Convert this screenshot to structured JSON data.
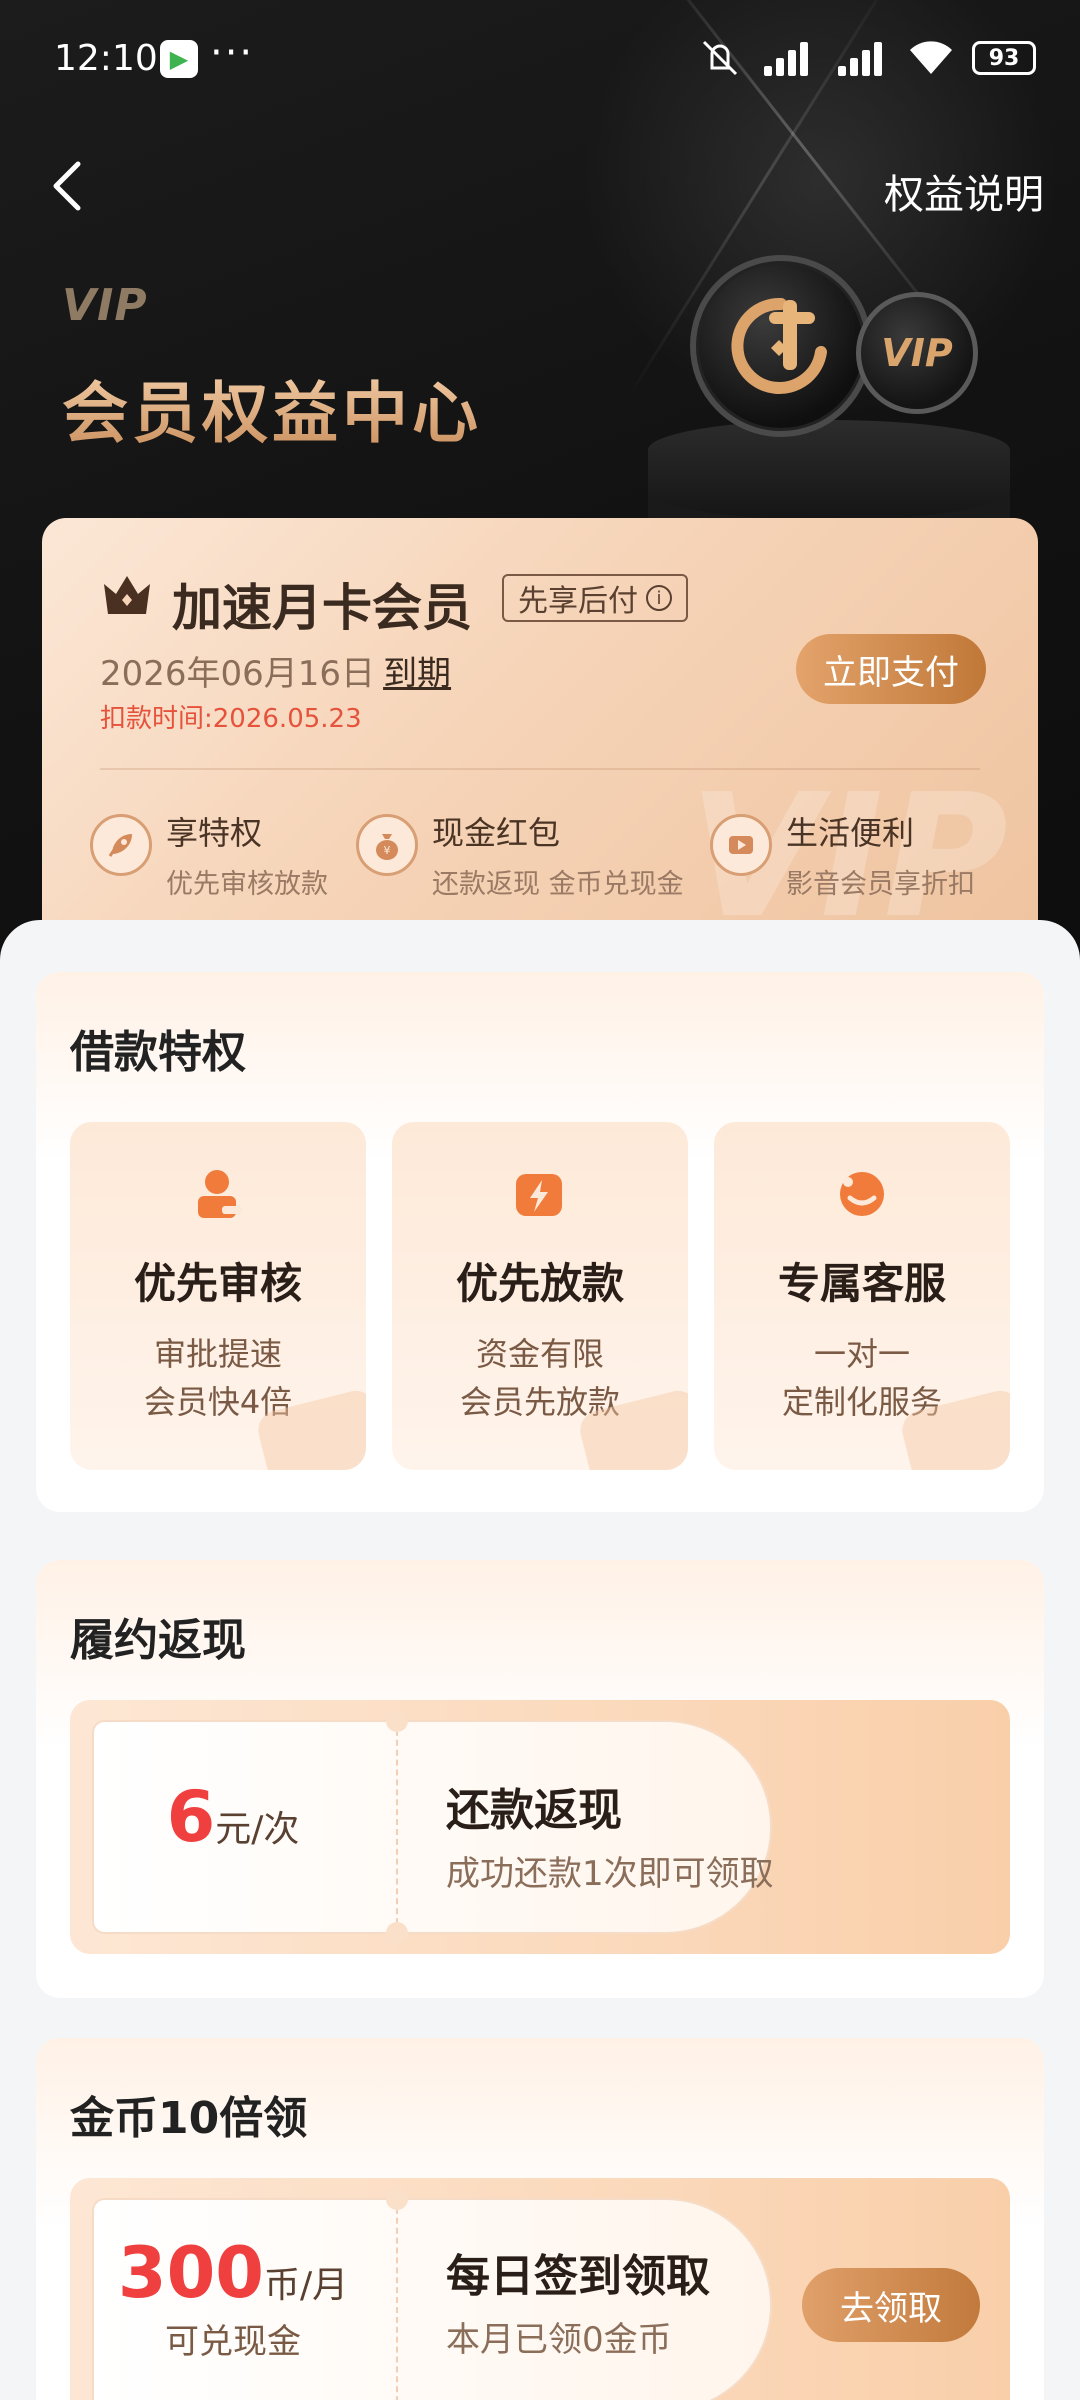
{
  "status_bar": {
    "time": "12:10",
    "more": "···",
    "battery": "93"
  },
  "header": {
    "vip_mark": "VIP",
    "title": "会员权益中心",
    "rights_link": "权益说明",
    "coin_label": "VIP"
  },
  "member": {
    "name": "加速月卡会员",
    "pay_later_tag": "先享后付",
    "info_icon": "i",
    "expire_date": "2026年06月16日",
    "expire_suffix": "到期",
    "deduct_time": "扣款时间:2026.05.23",
    "pay_button": "立即支付",
    "watermark": "VIP",
    "perks": [
      {
        "title": "享特权",
        "desc": "优先审核放款",
        "icon": "rocket-icon"
      },
      {
        "title": "现金红包",
        "desc": "还款返现 金币兑现金",
        "icon": "money-bag-icon"
      },
      {
        "title": "生活便利",
        "desc": "影音会员享折扣",
        "icon": "video-icon"
      }
    ]
  },
  "loan_privileges": {
    "title": "借款特权",
    "items": [
      {
        "title": "优先审核",
        "line1": "审批提速",
        "line2": "会员快4倍",
        "icon": "reviewer-icon"
      },
      {
        "title": "优先放款",
        "line1": "资金有限",
        "line2": "会员先放款",
        "icon": "lightning-card-icon"
      },
      {
        "title": "专属客服",
        "line1": "一对一",
        "line2": "定制化服务",
        "icon": "chat-bubble-icon"
      }
    ]
  },
  "cashback": {
    "title": "履约返现",
    "amount": "6",
    "unit": "元/次",
    "item_title": "还款返现",
    "item_desc": "成功还款1次即可领取"
  },
  "coins": {
    "title": "金币10倍领",
    "amount": "300",
    "unit": "币/月",
    "sub": "可兑现金",
    "item_title": "每日签到领取",
    "item_desc": "本月已领0金币",
    "button": "去领取"
  },
  "colors": {
    "accent": "#c98a52",
    "price_red": "#ef3f3f",
    "hero_bg": "#141414"
  }
}
